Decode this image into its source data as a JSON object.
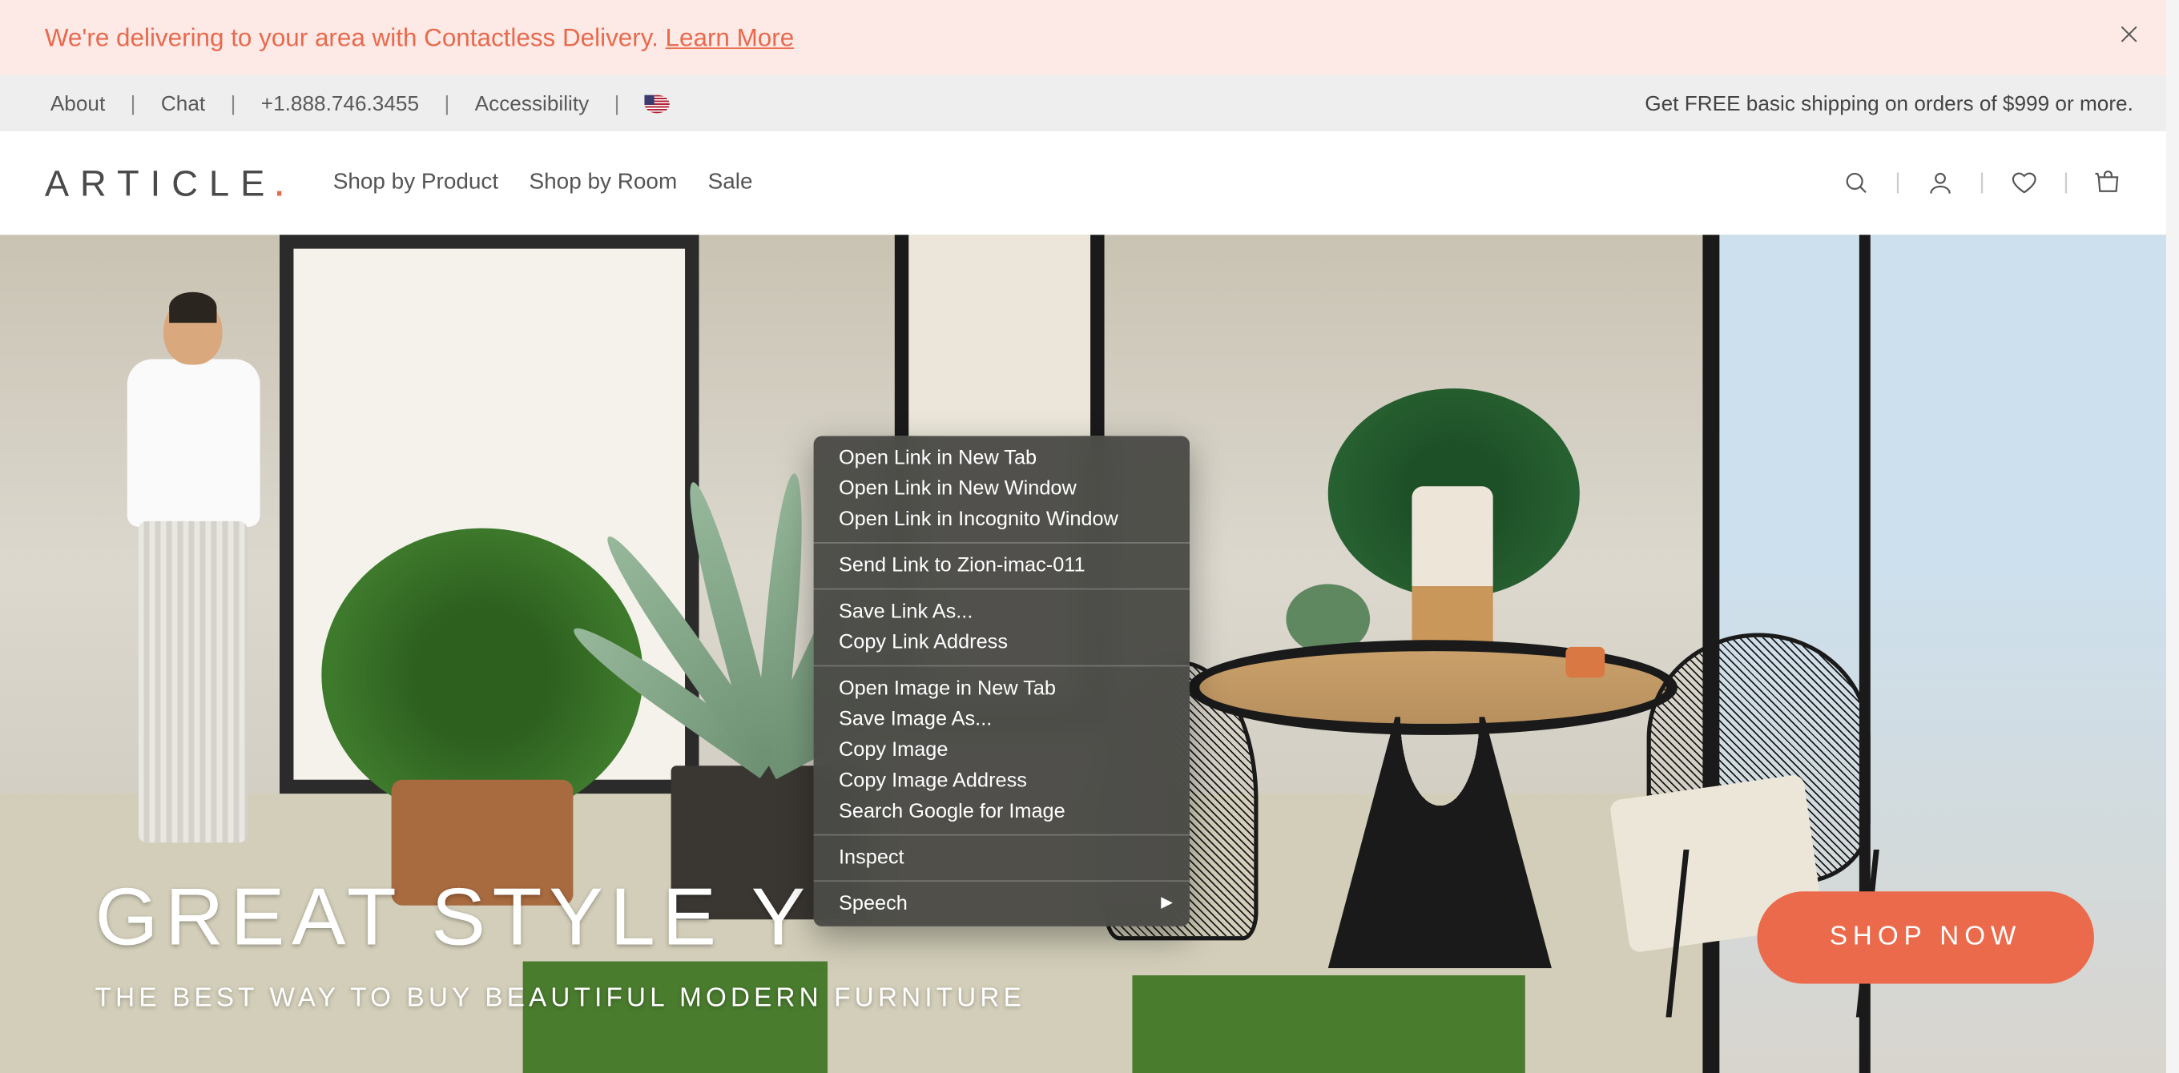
{
  "promo": {
    "text": "We're delivering to your area with Contactless Delivery. ",
    "link": "Learn More"
  },
  "util": {
    "about": "About",
    "chat": "Chat",
    "phone": "+1.888.746.3455",
    "accessibility": "Accessibility",
    "shipping": "Get FREE basic shipping on orders of $999 or more."
  },
  "logo": {
    "text": "ARTICLE",
    "dot": "."
  },
  "nav": {
    "shopProduct": "Shop by Product",
    "shopRoom": "Shop by Room",
    "sale": "Sale"
  },
  "hero": {
    "headline": "GREAT STYLE       Y",
    "sub": "THE BEST WAY TO BUY BEAUTIFUL MODERN FURNITURE",
    "cta": "SHOP NOW"
  },
  "ctx": {
    "openTab": "Open Link in New Tab",
    "openWindow": "Open Link in New Window",
    "openIncognito": "Open Link in Incognito Window",
    "sendLink": "Send Link to Zion-imac-011",
    "saveLink": "Save Link As...",
    "copyLink": "Copy Link Address",
    "openImage": "Open Image in New Tab",
    "saveImage": "Save Image As...",
    "copyImage": "Copy Image",
    "copyImageAddr": "Copy Image Address",
    "searchImage": "Search Google for Image",
    "inspect": "Inspect",
    "speech": "Speech"
  }
}
